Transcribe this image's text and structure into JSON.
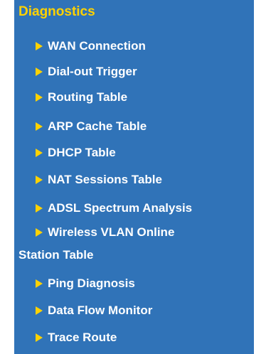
{
  "section": {
    "title": "Diagnostics"
  },
  "items": [
    {
      "label": "WAN Connection"
    },
    {
      "label": "Dial-out Trigger"
    },
    {
      "label": "Routing Table"
    },
    {
      "label": "ARP Cache Table"
    },
    {
      "label": "DHCP Table"
    },
    {
      "label": "NAT Sessions Table"
    },
    {
      "label": "ADSL Spectrum Analysis"
    },
    {
      "label": "Wireless VLAN Online",
      "label_line2": "Station Table"
    },
    {
      "label": "Ping Diagnosis"
    },
    {
      "label": "Data Flow Monitor"
    },
    {
      "label": "Trace Route"
    }
  ],
  "colors": {
    "panel_background": "#3073b8",
    "accent": "#ffd200",
    "text": "#ffffff"
  },
  "icons": {
    "item_arrow": "triangle-right-icon"
  }
}
